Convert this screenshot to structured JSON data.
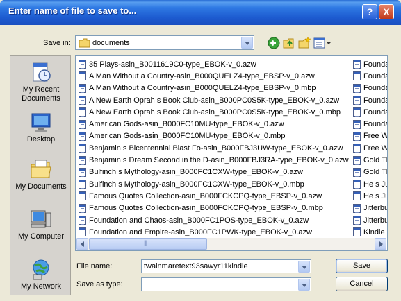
{
  "window": {
    "title": "Enter name of file to save to..."
  },
  "titlebar_buttons": {
    "help": "?",
    "close": "X"
  },
  "save_in": {
    "label": "Save in:",
    "value": "documents"
  },
  "toolbar_icons": [
    "back-icon",
    "up-folder-icon",
    "new-folder-icon",
    "views-menu-icon"
  ],
  "places": [
    {
      "label": "My Recent Documents",
      "icon": "recent-documents-icon"
    },
    {
      "label": "Desktop",
      "icon": "desktop-icon"
    },
    {
      "label": "My Documents",
      "icon": "my-documents-icon"
    },
    {
      "label": "My Computer",
      "icon": "my-computer-icon"
    },
    {
      "label": "My Network",
      "icon": "my-network-icon"
    }
  ],
  "files": [
    "35 Plays-asin_B0011619C0-type_EBOK-v_0.azw",
    "A Man Without a Country-asin_B000QUELZ4-type_EBSP-v_0.azw",
    "A Man Without a Country-asin_B000QUELZ4-type_EBSP-v_0.mbp",
    "A New Earth Oprah s Book Club-asin_B000PC0S5K-type_EBOK-v_0.azw",
    "A New Earth Oprah s Book Club-asin_B000PC0S5K-type_EBOK-v_0.mbp",
    "American Gods-asin_B000FC10MU-type_EBOK-v_0.azw",
    "American Gods-asin_B000FC10MU-type_EBOK-v_0.mbp",
    "Benjamin s Bicentennial Blast Fo-asin_B000FBJ3UW-type_EBOK-v_0.azw",
    "Benjamin s Dream Second in the D-asin_B000FBJ3RA-type_EBOK-v_0.azw",
    "Bulfinch s Mythology-asin_B000FC1CXW-type_EBOK-v_0.azw",
    "Bulfinch s Mythology-asin_B000FC1CXW-type_EBOK-v_0.mbp",
    "Famous Quotes Collection-asin_B000FCKCPQ-type_EBSP-v_0.azw",
    "Famous Quotes Collection-asin_B000FCKCPQ-type_EBSP-v_0.mbp",
    "Foundation and Chaos-asin_B000FC1POS-type_EBOK-v_0.azw",
    "Foundation and Empire-asin_B000FC1PWK-type_EBOK-v_0.azw"
  ],
  "files_col2": [
    "Founda",
    "Founda",
    "Founda",
    "Founda",
    "Founda",
    "Founda",
    "Free W",
    "Free W",
    "Gold Th",
    "Gold Th",
    "He s Ju",
    "He s Ju",
    "Jitterbu",
    "Jitterbu",
    "Kindle U"
  ],
  "file_name": {
    "label": "File name:",
    "value": "twainmaretext93sawyr11kindle"
  },
  "save_as_type": {
    "label": "Save as type:",
    "value": ""
  },
  "buttons": {
    "save": "Save",
    "cancel": "Cancel"
  },
  "colors": {
    "titlebar": "#2f7ae4",
    "dialog_bg": "#ece9d8",
    "field_border": "#7f9db9"
  }
}
